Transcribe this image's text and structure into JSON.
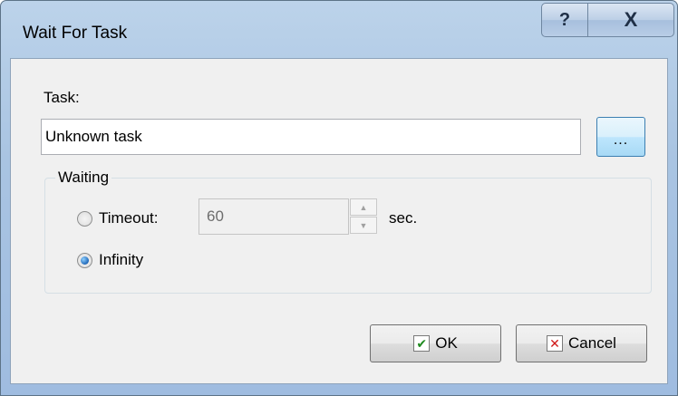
{
  "window": {
    "title": "Wait For Task"
  },
  "titlebar": {
    "help_glyph": "?",
    "close_glyph": "X"
  },
  "task": {
    "label": "Task:",
    "value": "Unknown task",
    "browse_label": "..."
  },
  "waiting": {
    "group_label": "Waiting",
    "timeout_label": "Timeout:",
    "timeout_value": "60",
    "timeout_unit": "sec.",
    "infinity_label": "Infinity",
    "selected": "infinity",
    "timeout_enabled": false
  },
  "buttons": {
    "ok_label": "OK",
    "cancel_label": "Cancel"
  },
  "icons": {
    "ok": "check-icon",
    "cancel": "x-icon",
    "spin_up": "triangle-up-icon",
    "spin_down": "triangle-down-icon"
  },
  "colors": {
    "titlebar": "#a9c4e2",
    "client_bg": "#f0f0f0",
    "check_green": "#1f8a1f",
    "cancel_red": "#d01818"
  }
}
